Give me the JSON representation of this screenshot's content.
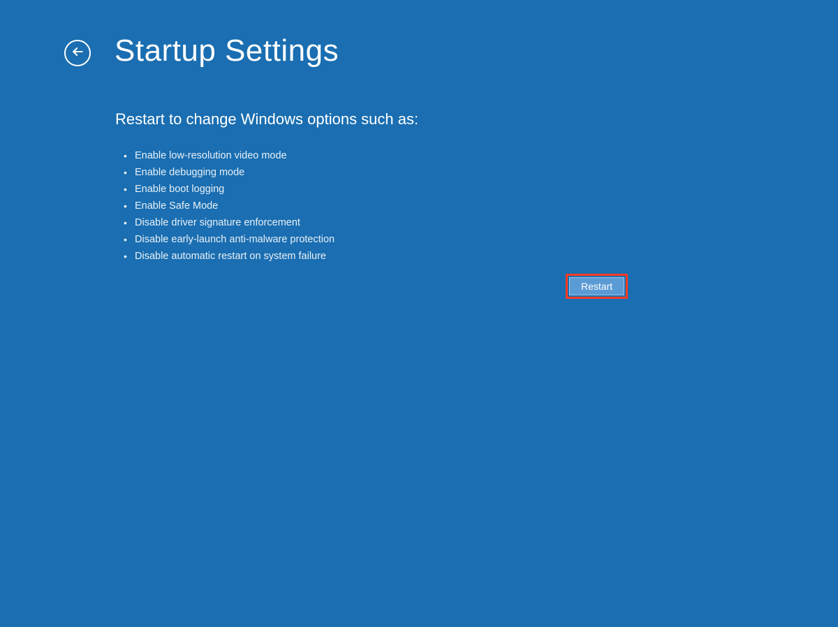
{
  "header": {
    "title": "Startup Settings"
  },
  "content": {
    "subtitle": "Restart to change Windows options such as:",
    "options": [
      "Enable low-resolution video mode",
      "Enable debugging mode",
      "Enable boot logging",
      "Enable Safe Mode",
      "Disable driver signature enforcement",
      "Disable early-launch anti-malware protection",
      "Disable automatic restart on system failure"
    ]
  },
  "buttons": {
    "restart": "Restart"
  }
}
